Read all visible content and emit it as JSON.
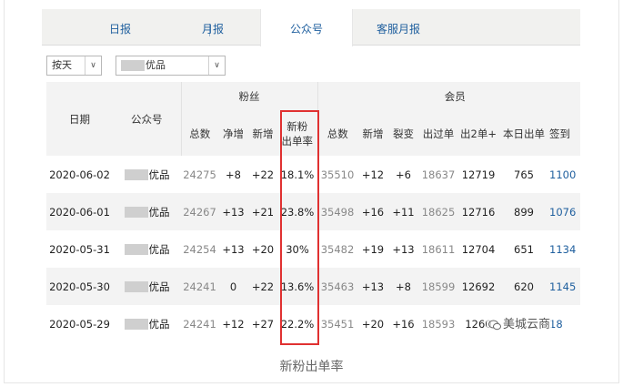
{
  "tabs": [
    {
      "label": "日报",
      "active": false
    },
    {
      "label": "月报",
      "active": false
    },
    {
      "label": "公众号",
      "active": true
    },
    {
      "label": "客服月报",
      "active": false
    }
  ],
  "filters": {
    "period": "按天",
    "account": "优品"
  },
  "table": {
    "headers": {
      "date": "日期",
      "account": "公众号",
      "fans_group": "粉丝",
      "members_group": "会员",
      "fans_cols": [
        "总数",
        "净增",
        "新增",
        "新粉\n出单率"
      ],
      "member_cols": [
        "总数",
        "新增",
        "裂变",
        "出过单",
        "出2单+",
        "本日出单",
        "签到"
      ]
    },
    "rows": [
      {
        "date": "2020-06-02",
        "account": "优品",
        "fans_total": "24275",
        "fans_net": "+8",
        "fans_new": "+22",
        "rate": "18.1%",
        "mem_total": "35510",
        "mem_new": "+12",
        "fission": "+6",
        "ordered": "18637",
        "ordered2": "12719",
        "today": "765",
        "checkin": "1100"
      },
      {
        "date": "2020-06-01",
        "account": "优品",
        "fans_total": "24267",
        "fans_net": "+13",
        "fans_new": "+21",
        "rate": "23.8%",
        "mem_total": "35498",
        "mem_new": "+16",
        "fission": "+11",
        "ordered": "18625",
        "ordered2": "12716",
        "today": "899",
        "checkin": "1076"
      },
      {
        "date": "2020-05-31",
        "account": "优品",
        "fans_total": "24254",
        "fans_net": "+13",
        "fans_new": "+20",
        "rate": "30%",
        "mem_total": "35482",
        "mem_new": "+19",
        "fission": "+13",
        "ordered": "18611",
        "ordered2": "12704",
        "today": "651",
        "checkin": "1134"
      },
      {
        "date": "2020-05-30",
        "account": "优品",
        "fans_total": "24241",
        "fans_net": "0",
        "fans_new": "+22",
        "rate": "13.6%",
        "mem_total": "35463",
        "mem_new": "+13",
        "fission": "+8",
        "ordered": "18599",
        "ordered2": "12692",
        "today": "620",
        "checkin": "1145"
      },
      {
        "date": "2020-05-29",
        "account": "优品",
        "fans_total": "24241",
        "fans_net": "+12",
        "fans_new": "+27",
        "rate": "22.2%",
        "mem_total": "35451",
        "mem_new": "+20",
        "fission": "+16",
        "ordered": "18593",
        "ordered2": "1260",
        "today": "",
        "checkin": "18"
      }
    ]
  },
  "watermark": "美城云商",
  "caption": "新粉出单率",
  "colors": {
    "highlight": "#e03131",
    "link": "#1f5f9e"
  }
}
